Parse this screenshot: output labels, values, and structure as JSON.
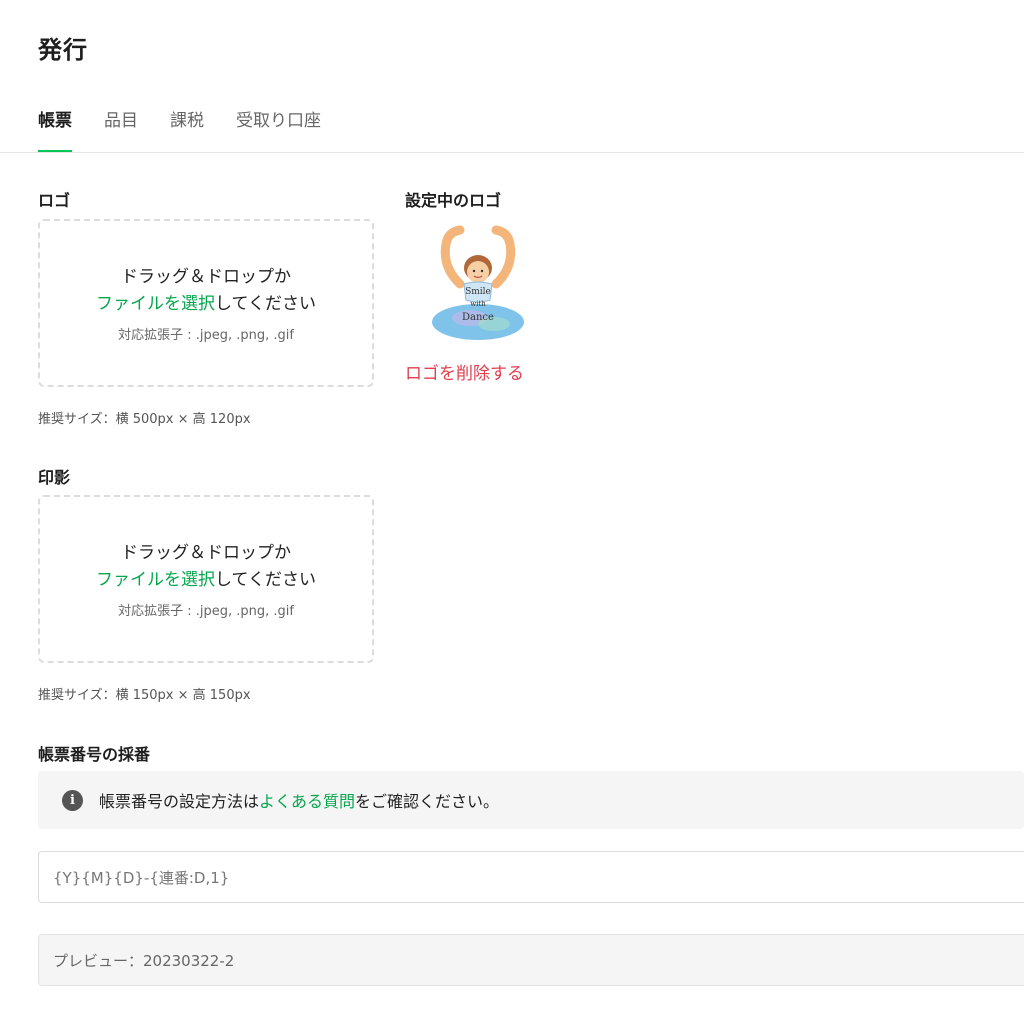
{
  "page_title": "発行",
  "tabs": [
    {
      "label": "帳票",
      "active": true
    },
    {
      "label": "品目",
      "active": false
    },
    {
      "label": "課税",
      "active": false
    },
    {
      "label": "受取り口座",
      "active": false
    }
  ],
  "logo_section": {
    "label": "ロゴ",
    "dropzone": {
      "line1": "ドラッグ＆ドロップか",
      "link": "ファイルを選択",
      "line2_suffix": "してください",
      "extensions": "対応拡張子 : .jpeg, .png, .gif"
    },
    "recommended_size": "推奨サイズ：横 500px × 高 120px"
  },
  "current_logo": {
    "label": "設定中のロゴ",
    "image_text": "Smile with Dance",
    "delete_label": "ロゴを削除する"
  },
  "stamp_section": {
    "label": "印影",
    "dropzone": {
      "line1": "ドラッグ＆ドロップか",
      "link": "ファイルを選択",
      "line2_suffix": "してください",
      "extensions": "対応拡張子 : .jpeg, .png, .gif"
    },
    "recommended_size": "推奨サイズ：横 150px × 高 150px"
  },
  "numbering": {
    "label": "帳票番号の採番",
    "info_prefix": "帳票番号の設定方法は",
    "info_link": "よくある質問",
    "info_suffix": "をご確認ください。",
    "format_value": "{Y}{M}{D}-{連番:D,1}",
    "preview": "プレビュー：20230322-2"
  },
  "colors": {
    "accent_green": "#06c755",
    "link_green": "#06a64d",
    "delete_red": "#e03e4e"
  }
}
